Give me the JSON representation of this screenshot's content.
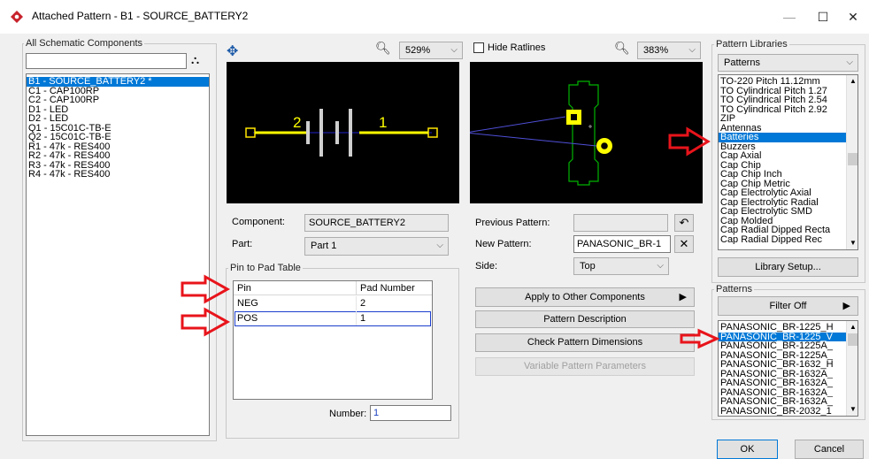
{
  "window": {
    "title": "Attached Pattern  -  B1 - SOURCE_BATTERY2",
    "minimize": "—",
    "maximize": "☐",
    "close": "✕"
  },
  "components": {
    "legend": "All Schematic Components",
    "search_value": "",
    "items": [
      "B1 - SOURCE_BATTERY2 *",
      "C1 - CAP100RP",
      "C2 - CAP100RP",
      "D1 - LED",
      "D2 - LED",
      "Q1 - 15C01C-TB-E",
      "Q2 - 15C01C-TB-E",
      "R1 - 47k - RES400",
      "R2 - 47k - RES400",
      "R3 - 47k - RES400",
      "R4 - 47k - RES400"
    ],
    "selected_index": 0
  },
  "schematic": {
    "zoom": "529%",
    "pin2": "2",
    "pin1": "1"
  },
  "pcb": {
    "hide_ratlines_label": "Hide Ratlines",
    "hide_ratlines_checked": false,
    "zoom": "383%"
  },
  "component_form": {
    "component_label": "Component:",
    "component_value": "SOURCE_BATTERY2",
    "part_label": "Part:",
    "part_value": "Part 1"
  },
  "pin_table": {
    "legend": "Pin to Pad Table",
    "headers": [
      "Pin",
      "Pad Number"
    ],
    "rows": [
      {
        "pin": "NEG",
        "pad": "2"
      },
      {
        "pin": "POS",
        "pad": "1"
      }
    ],
    "number_label": "Number:",
    "number_value": "1"
  },
  "pattern_form": {
    "previous_label": "Previous Pattern:",
    "previous_value": "",
    "new_label": "New Pattern:",
    "new_value": "PANASONIC_BR-1",
    "side_label": "Side:",
    "side_value": "Top",
    "undo_icon": "↶",
    "clear_icon": "✕"
  },
  "actions": {
    "apply": "Apply to Other Components",
    "apply_arrow": "▶",
    "description": "Pattern Description",
    "check": "Check Pattern Dimensions",
    "variable": "Variable Pattern Parameters"
  },
  "libraries": {
    "legend": "Pattern Libraries",
    "select_value": "Patterns",
    "items": [
      "TO-220 Pitch 11.12mm",
      "TO Cylindrical Pitch 1.27",
      "TO Cylindrical Pitch 2.54",
      "TO Cylindrical Pitch 2.92",
      "ZIP",
      "Antennas",
      "Batteries",
      "Buzzers",
      "Cap Axial",
      "Cap Chip",
      "Cap Chip Inch",
      "Cap Chip Metric",
      "Cap Electrolytic Axial",
      "Cap Electrolytic Radial",
      "Cap Electrolytic SMD",
      "Cap Molded",
      "Cap Radial Dipped Recta",
      "Cap Radial Dipped Rec"
    ],
    "selected_index": 6,
    "setup_button": "Library Setup..."
  },
  "patterns": {
    "legend": "Patterns",
    "filter_button": "Filter Off",
    "filter_arrow": "▶",
    "items": [
      "PANASONIC_BR-1225_H",
      "PANASONIC_BR-1225_V",
      "PANASONIC_BR-1225A_",
      "PANASONIC_BR-1225A_",
      "PANASONIC_BR-1632_H",
      "PANASONIC_BR-1632A_",
      "PANASONIC_BR-1632A_",
      "PANASONIC_BR-1632A_",
      "PANASONIC_BR-1632A_",
      "PANASONIC_BR-2032_1"
    ],
    "selected_index": 1
  },
  "footer": {
    "ok": "OK",
    "cancel": "Cancel"
  },
  "colors": {
    "accent": "#0078d7",
    "annotation_arrow": "#e8141b",
    "trace": "#ffff00",
    "ratline": "#4f4fd8",
    "outline": "#00b400"
  }
}
